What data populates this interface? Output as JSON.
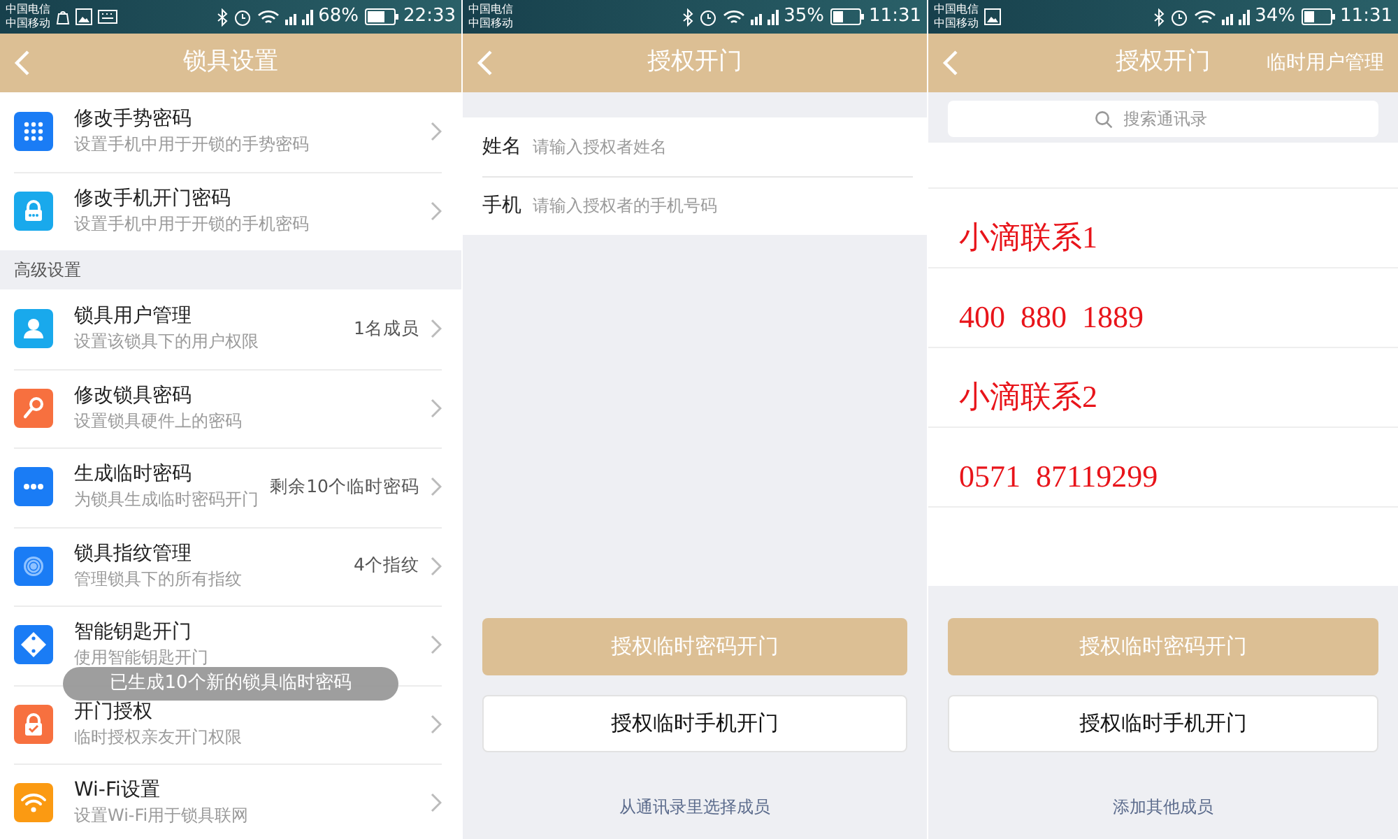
{
  "screens": [
    {
      "status_bar": {
        "carriers": [
          "中国电信",
          "中国移动"
        ],
        "battery": "68%",
        "time": "22:33"
      },
      "header": {
        "title": "锁具设置"
      },
      "sections": [
        {
          "items": [
            {
              "title": "修改手势密码",
              "subtitle": "设置手机中用于开锁的手势密码"
            },
            {
              "title": "修改手机开门密码",
              "subtitle": "设置手机中用于开锁的手机密码"
            }
          ]
        },
        {
          "title": "高级设置",
          "items": [
            {
              "title": "锁具用户管理",
              "subtitle": "设置该锁具下的用户权限",
              "detail": "1名成员"
            },
            {
              "title": "修改锁具密码",
              "subtitle": "设置锁具硬件上的密码"
            },
            {
              "title": "生成临时密码",
              "subtitle": "为锁具生成临时密码开门",
              "detail": "剩余10个临时密码"
            },
            {
              "title": "锁具指纹管理",
              "subtitle": "管理锁具下的所有指纹",
              "detail": "4个指纹"
            },
            {
              "title": "智能钥匙开门",
              "subtitle": "使用智能钥匙开门"
            },
            {
              "title": "开门授权",
              "subtitle": "临时授权亲友开门权限"
            },
            {
              "title": "Wi-Fi设置",
              "subtitle": "设置Wi-Fi用于锁具联网"
            }
          ]
        }
      ],
      "toast": "已生成10个新的锁具临时密码"
    },
    {
      "status_bar": {
        "carriers": [
          "中国电信",
          "中国移动"
        ],
        "battery": "35%",
        "time": "11:31"
      },
      "header": {
        "title": "授权开门"
      },
      "form": [
        {
          "label": "姓名",
          "placeholder": "请输入授权者姓名"
        },
        {
          "label": "手机",
          "placeholder": "请输入授权者的手机号码"
        }
      ],
      "buttons": [
        {
          "label": "授权临时密码开门",
          "kind": "primary"
        },
        {
          "label": "授权临时手机开门",
          "kind": "secondary"
        }
      ],
      "link": "从通讯录里选择成员"
    },
    {
      "status_bar": {
        "carriers": [
          "中国电信",
          "中国移动"
        ],
        "battery": "34%",
        "time": "11:31"
      },
      "header": {
        "title": "授权开门",
        "action": "临时用户管理"
      },
      "search": {
        "placeholder": "搜索通讯录"
      },
      "contacts": [
        "小滴联系1",
        "400  880  1889",
        "小滴联系2",
        "0571  87119299"
      ],
      "buttons": [
        {
          "label": "授权临时密码开门",
          "kind": "primary"
        },
        {
          "label": "授权临时手机开门",
          "kind": "secondary"
        }
      ],
      "link": "添加其他成员"
    }
  ]
}
